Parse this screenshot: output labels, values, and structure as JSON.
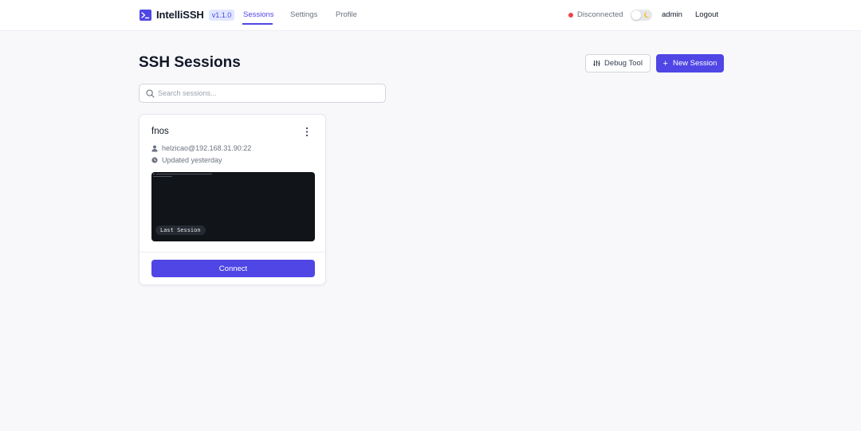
{
  "app": {
    "name": "IntelliSSH",
    "version": "v1.1.0",
    "brand_color": "#4f46e5"
  },
  "nav": {
    "tabs": [
      {
        "label": "Sessions",
        "active": true
      },
      {
        "label": "Settings",
        "active": false
      },
      {
        "label": "Profile",
        "active": false
      }
    ]
  },
  "status": {
    "label": "Disconnected",
    "color": "#ef4444"
  },
  "theme_toggle": {
    "icon": "moon-icon",
    "dark_mode": false
  },
  "user": {
    "name": "admin",
    "logout_label": "Logout"
  },
  "page": {
    "title": "SSH Sessions",
    "debug_label": "Debug Tool",
    "new_session_label": "New Session"
  },
  "search": {
    "placeholder": "Search sessions...",
    "value": ""
  },
  "sessions": [
    {
      "name": "fnos",
      "host": "helzicao@192.168.31.90:22",
      "updated": "Updated yesterday",
      "preview_label": "Last Session",
      "connect_label": "Connect"
    }
  ]
}
